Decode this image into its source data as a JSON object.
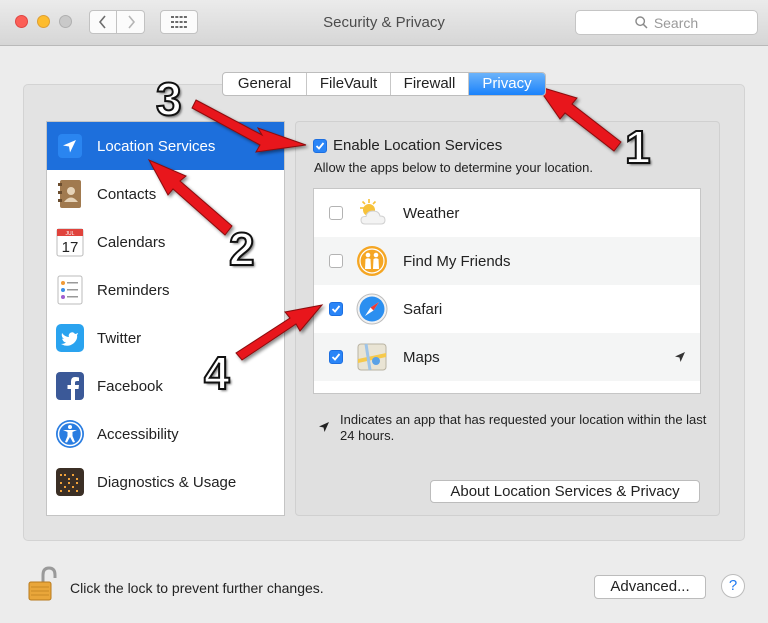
{
  "window": {
    "title": "Security & Privacy"
  },
  "search": {
    "placeholder": "Search"
  },
  "tabs": [
    {
      "label": "General",
      "active": false
    },
    {
      "label": "FileVault",
      "active": false
    },
    {
      "label": "Firewall",
      "active": false
    },
    {
      "label": "Privacy",
      "active": true
    }
  ],
  "sidebar": {
    "items": [
      {
        "label": "Location Services",
        "icon": "location-arrow-icon",
        "selected": true
      },
      {
        "label": "Contacts",
        "icon": "contacts-book-icon",
        "selected": false
      },
      {
        "label": "Calendars",
        "icon": "calendar-icon",
        "selected": false
      },
      {
        "label": "Reminders",
        "icon": "reminders-list-icon",
        "selected": false
      },
      {
        "label": "Twitter",
        "icon": "twitter-bird-icon",
        "selected": false
      },
      {
        "label": "Facebook",
        "icon": "facebook-f-icon",
        "selected": false
      },
      {
        "label": "Accessibility",
        "icon": "accessibility-person-icon",
        "selected": false
      },
      {
        "label": "Diagnostics & Usage",
        "icon": "diagnostics-grid-icon",
        "selected": false
      }
    ],
    "calendar_month": "JUL",
    "calendar_day": "17"
  },
  "location": {
    "enable_label": "Enable Location Services",
    "enable_checked": true,
    "description": "Allow the apps below to determine your location."
  },
  "apps": [
    {
      "label": "Weather",
      "checked": false,
      "icon": "weather-sun-cloud-icon",
      "recent": false
    },
    {
      "label": "Find My Friends",
      "checked": false,
      "icon": "find-my-friends-icon",
      "recent": false
    },
    {
      "label": "Safari",
      "checked": true,
      "icon": "safari-compass-icon",
      "recent": false
    },
    {
      "label": "Maps",
      "checked": true,
      "icon": "maps-icon",
      "recent": true
    }
  ],
  "legend": {
    "text": "Indicates an app that has requested your location within the last 24 hours."
  },
  "buttons": {
    "about": "About Location Services & Privacy",
    "advanced": "Advanced...",
    "help": "?"
  },
  "lock": {
    "text": "Click the lock to prevent further changes."
  },
  "annotations": {
    "n1": "1",
    "n2": "2",
    "n3": "3",
    "n4": "4"
  },
  "colors": {
    "accent": "#1d6fdc",
    "annotation_arrow": "#e8131b"
  }
}
